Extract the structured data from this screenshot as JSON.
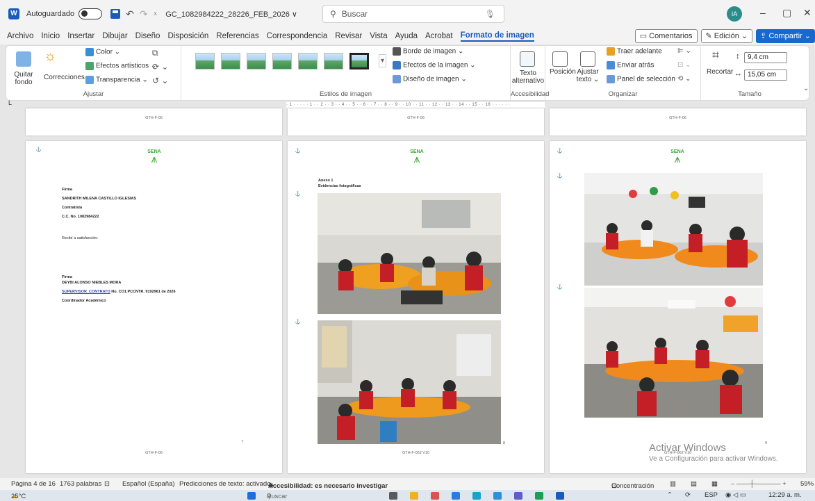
{
  "titlebar": {
    "autosave_label": "Autoguardado",
    "filename": "GC_1082984222_28226_FEB_2026 ∨",
    "search_placeholder": "Buscar",
    "avatar_initials": "IA"
  },
  "menu": {
    "items": [
      "Archivo",
      "Inicio",
      "Insertar",
      "Dibujar",
      "Diseño",
      "Disposición",
      "Referencias",
      "Correspondencia",
      "Revisar",
      "Vista",
      "Ayuda",
      "Acrobat",
      "Formato de imagen"
    ],
    "comments_label": "Comentarios",
    "edit_label": "Edición ⌄",
    "share_label": "Compartir ⌄"
  },
  "ribbon": {
    "ajustar": {
      "group_label": "Ajustar",
      "quitar_fondo": "Quitar fondo",
      "correcciones": "Correcciones",
      "color": "Color ⌄",
      "efectos_artisticos": "Efectos artísticos ⌄",
      "transparencia": "Transparencia ⌄"
    },
    "estilos": {
      "group_label": "Estilos de imagen",
      "borde": "Borde de imagen ⌄",
      "efectos": "Efectos de la imagen ⌄",
      "diseno": "Diseño de imagen ⌄"
    },
    "accesibilidad": {
      "group_label": "Accesibilidad",
      "texto_alternativo": "Texto alternativo"
    },
    "organizar": {
      "group_label": "Organizar",
      "posicion": "Posición",
      "ajustar_texto": "Ajustar texto ⌄",
      "traer_adelante": "Traer adelante",
      "enviar_atras": "Enviar atrás",
      "panel_seleccion": "Panel de selección"
    },
    "tamano": {
      "group_label": "Tamaño",
      "recortar": "Recortar",
      "height": "9,4 cm",
      "width": "15,05 cm"
    }
  },
  "ruler_text": "· 1 · · · · · 1 · · 2 · · 3 · · 4 · · 5 · · 6 · · 7 · · 8 · · 9 · · 10 · · 11 · · 12 · · 13 · · 14 · · 15 · · 16 · · · · · ·",
  "pages": {
    "top_footer": "GTH-F-06",
    "top_footer_mid": "GTH-F-06",
    "top_footer_right": "GTH-F-06",
    "sena_text": "SENA",
    "p1": {
      "firma1": "Firma",
      "name1": "SANDRITH MILENA CASTILLO IGLESIAS",
      "role1": "Contratista",
      "cc": "C.C. No. 1082984222",
      "recibi": "Recibí a satisfacción:",
      "firma2": "Firma",
      "name2": "DEYBI ALONSO NIEBLES MORA",
      "supervisor_link": "SUPERVISOR_CONTRATO",
      "supervisor_rest": "No. CO1.PCCNTR. 9192961 de 2026",
      "role2": "Coordinador Académico",
      "page_num": "7",
      "footer": "GTH-F-06"
    },
    "p2": {
      "anexo": "Anexo 1",
      "evidencias": "Evidencias fotográficas",
      "page_num": "8",
      "footer": "GTH-F-062 V10"
    },
    "p3": {
      "page_num": "9",
      "footer": "GTH-F-062 V10"
    }
  },
  "watermark": {
    "line1": "Activar Windows",
    "line2": "Ve a Configuración para activar Windows."
  },
  "status": {
    "page": "Página 4 de 16",
    "words": "1763 palabras",
    "lang": "Español (España)",
    "predictions": "Predicciones de texto: activado",
    "accessibility": "Accesibilidad: es necesario investigar",
    "focus": "Concentración",
    "zoom": "59%"
  },
  "taskbar": {
    "weather": "25°C",
    "search": "Buscar",
    "lang": "ESP",
    "time": "12:29 a. m."
  }
}
